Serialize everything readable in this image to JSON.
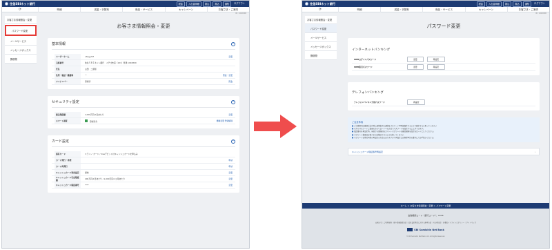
{
  "brand": "住信SBIネット銀行",
  "header": {
    "buttons": [
      "税金",
      "入出金明細",
      "振込",
      "振込",
      "通知",
      "ログアウト"
    ]
  },
  "nav": {
    "items": [
      "明細",
      "送金・手数料",
      "商品・サービス",
      "キャンペーン",
      "お客さま・ご案内"
    ]
  },
  "subline": "ID: 1410000",
  "left": {
    "sidebar": {
      "head": "お客さま情報照会・変更",
      "items": [
        "パスワード変更",
        "メールサービス",
        "メッセージボックス",
        "郵便物"
      ]
    },
    "title": "お客さま情報照会・変更",
    "basic": {
      "title": "基本情報",
      "rows": [
        {
          "label": "ユーザーネーム",
          "value": "uSag_Pdf",
          "action": "変更"
        },
        {
          "label": "口座番号",
          "value": "住信ＳＢＩネット銀行　イチゴ支店（101）普通 1010800",
          "action": ""
        },
        {
          "label": "氏名",
          "value": "山田　二郎様",
          "action": ""
        },
        {
          "label": "住所・電話・職業等",
          "value": "ー",
          "action": "照会・変更"
        },
        {
          "label": "マイナンバー",
          "value": "登録済",
          "action": "照会"
        }
      ]
    },
    "security": {
      "title": "セキュリティ設定",
      "rows": [
        {
          "label": "振込限度額",
          "value": "1,000万円/1日あたり",
          "action": "変更"
        },
        {
          "label": "スマート認証",
          "value": "登録済み",
          "action": "機種変更 登録解除"
        }
      ]
    },
    "card": {
      "title": "カード設定",
      "rows": [
        {
          "label": "保有カード",
          "value": "ミライノ カード / Visaデビット付キャッシュカードを申込み",
          "action": ""
        },
        {
          "label": "カード発行・再発",
          "value": "",
          "action": "申請"
        },
        {
          "label": "カード再発行",
          "value": "",
          "action": "申請"
        },
        {
          "label": "キャッシュカード利用設定",
          "value": "通常",
          "action": "変更"
        },
        {
          "label": "キャッシュカード引出限度額",
          "value": "200万円/1日あたり / 1,000万円/1ヵ月あたり",
          "action": "変更"
        },
        {
          "label": "キャッシュカード暗証番号",
          "value": "****",
          "action": "変更"
        }
      ]
    }
  },
  "right": {
    "sidebar": {
      "head": "お客さま情報照会・変更",
      "items": [
        "パスワード変更",
        "メールサービス",
        "メッセージボックス",
        "郵便物"
      ]
    },
    "title": "パスワード変更",
    "internet": {
      "title": "インターネットバンキング",
      "rows": [
        {
          "label": "WEBログインパスワード",
          "buttons": [
            "変更",
            "再設定"
          ]
        },
        {
          "label": "WEB取引パスワード",
          "buttons": [
            "変更",
            "再設定"
          ]
        }
      ]
    },
    "telephone": {
      "title": "テレフォンバンキング",
      "rows": [
        {
          "label": "テレフォンバンキング用パスワード",
          "buttons": [
            "再設定"
          ]
        }
      ]
    },
    "notice": {
      "title": "ご注意事項",
      "items": [
        "ご注意事項の確認方法が別に画像表示の通知をパスワード不明誤操作することで確定すると思ってください",
        "以下のパスワードご変更の方よりロードへの方法でパスワードを設定することができます。",
        "電話番号を再設定時、当日から保険日をスマートパスワードの確認通知を設定をロードとしてください。",
        "パスワード変更はお客さまの店舗はできることを知ってください",
        "パスワードは他社同様の再設定の方法もありますので再設定とお客様申告の番号にてお手続きください。"
      ]
    },
    "link": "キャッシュカード暗証番号再設定",
    "footer": {
      "breadcrumb": "ホーム ＞ お客さま情報照会・変更 ＞ パスワード変更",
      "code": "金融機関コード（銀行コード）：0038",
      "links": "お知らせ｜ご利用規約｜個人情報保護方針｜反社会的勢力に対する基本方針｜その他方針｜各種ガイドラインとポリシー｜サイトマップ",
      "logo": "SBI Sumishin Net Bank",
      "copyright": "© SBI Sumishin Net Bank, Ltd. All Rights Reserved."
    }
  },
  "colors": {
    "header": "#1d3b73",
    "accent": "#2a64b3",
    "arrow": "#ef4d4d",
    "highlight": "#e53935"
  }
}
